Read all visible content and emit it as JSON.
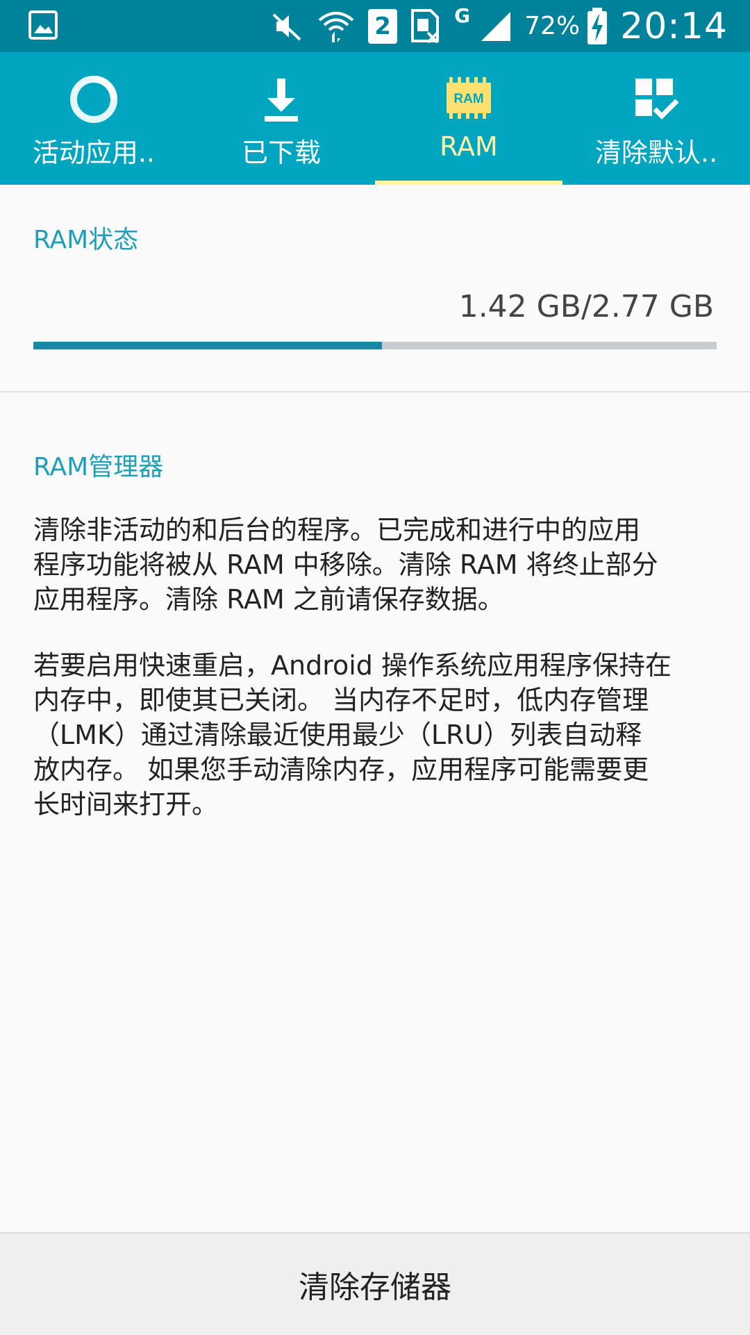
{
  "status_bar": {
    "battery": "72%",
    "time": "20:14",
    "network": "G",
    "sim_number": "2",
    "icons": [
      "gallery-icon",
      "mute-icon",
      "wifi-icon",
      "sim2-icon",
      "no-sim-icon",
      "signal-icon",
      "battery-charging-icon"
    ]
  },
  "tabs": [
    {
      "label": "活动应用..",
      "icon": "active-apps-icon",
      "active": false
    },
    {
      "label": "已下载",
      "icon": "download-icon",
      "active": false
    },
    {
      "label": "RAM",
      "icon": "ram-chip-icon",
      "active": true,
      "icon_text": "RAM"
    },
    {
      "label": "清除默认..",
      "icon": "clear-defaults-icon",
      "active": false
    }
  ],
  "ram_status": {
    "title": "RAM状态",
    "usage_text": "1.42 GB/2.77 GB",
    "used_fraction": 0.51
  },
  "ram_manager": {
    "title": "RAM管理器",
    "paragraph1_lines": [
      "清除非活动的和后台的程序。已完成和进行中的应用",
      "程序功能将被从 RAM 中移除。清除 RAM 将终止部分",
      "应用程序。清除 RAM 之前请保存数据。"
    ],
    "paragraph2_lines": [
      "若要启用快速重启，Android 操作系统应用程序保持在",
      "内存中，即使其已关闭。 当内存不足时，低内存管理",
      "（LMK）通过清除最近使用最少（LRU）列表自动释",
      "放内存。 如果您手动清除内存，应用程序可能需要更",
      "长时间来打开。"
    ]
  },
  "bottom_button": {
    "label": "清除存储器"
  },
  "colors": {
    "status_bar": "#00839a",
    "tab_bar": "#00a6bf",
    "active_tab": "#fff3a6",
    "section_title": "#1e9fb8",
    "progress_fill": "#1b86a3",
    "progress_track": "#c9cdd2"
  }
}
